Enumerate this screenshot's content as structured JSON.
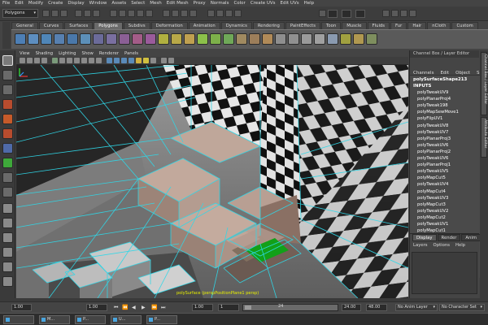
{
  "menubar": {
    "items": [
      "File",
      "Edit",
      "Modify",
      "Create",
      "Display",
      "Window",
      "Assets",
      "Select",
      "Mesh",
      "Edit Mesh",
      "Proxy",
      "Normals",
      "Color",
      "Create UVs",
      "Edit UVs",
      "Help"
    ]
  },
  "status_line": {
    "mode": "Polygons"
  },
  "shelf": {
    "tabs": [
      "General",
      "Curves",
      "Surfaces",
      "Polygons",
      "Subdivs",
      "Deformation",
      "Animation",
      "Dynamics",
      "Rendering",
      "PaintEffects",
      "Toon",
      "Muscle",
      "Fluids",
      "Fur",
      "Hair",
      "nCloth",
      "Custom"
    ],
    "active_tab": "Polygons"
  },
  "panel": {
    "menu": [
      "View",
      "Shading",
      "Lighting",
      "Show",
      "Renderer",
      "Panels"
    ]
  },
  "viewport": {
    "hud_text": "polySurface (perspPositionPlane1 persp)"
  },
  "channel_box": {
    "header": "Channel Box / Layer Editor",
    "menu": [
      "Channels",
      "Edit",
      "Object",
      "Show"
    ],
    "shape_name": "polySurfaceShape213",
    "inputs_label": "INPUTS",
    "nodes": [
      "polyTweakUV9",
      "polyPlanarProj4",
      "polyTweak198",
      "polyMapSewMove1",
      "polyFlipUV1",
      "polyTweakUV8",
      "polyTweakUV7",
      "polyPlanarProj3",
      "polyTweakUV6",
      "polyPlanarProj2",
      "polyTweakUV6",
      "polyPlanarProj1",
      "polyTweakUV5",
      "polyMapCut5",
      "polyTweakUV4",
      "polyMapCut4",
      "polyTweakUV3",
      "polyMapCut3",
      "polyTweakUV2",
      "polyMapCut2",
      "polyTweakUV1",
      "polyMapCut1"
    ]
  },
  "layer_editor": {
    "tabs": [
      "Display",
      "Render",
      "Anim"
    ],
    "active_tab": "Display",
    "menu": [
      "Layers",
      "Options",
      "Help"
    ]
  },
  "side_tabs": [
    "Channel Box / Layer Editor",
    "Attribute Editor"
  ],
  "time_range": {
    "start": "1.00",
    "current": "1.00",
    "slider_start": "1",
    "slider_end": "24",
    "range_start": "1.00",
    "range_end": "24.00",
    "end": "48.00",
    "anim_layer": "No Anim Layer",
    "character_set": "No Character Set"
  },
  "playback": [
    "⏮",
    "⏪",
    "◀",
    "▶",
    "⏩",
    "⏭"
  ],
  "taskbar": {
    "buttons": [
      "",
      "M...",
      "P...",
      "U...",
      "P..."
    ]
  },
  "colors": {
    "wireframe": "#2fd8e8",
    "selected_face": "#12a018",
    "hud": "#e8f000"
  }
}
